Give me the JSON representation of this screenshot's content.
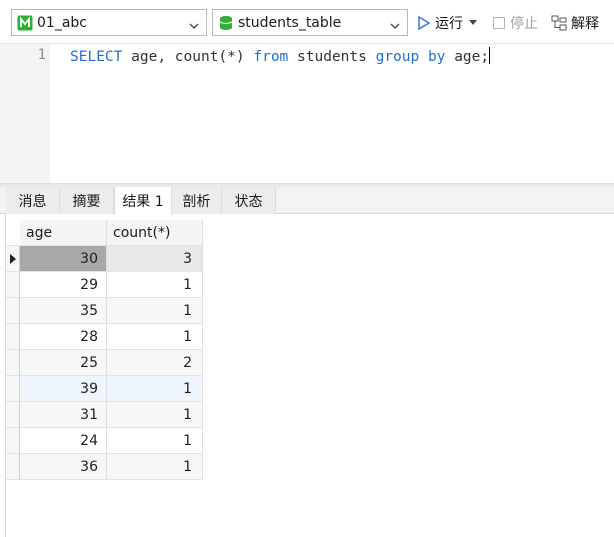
{
  "toolbar": {
    "database": "01_abc",
    "table": "students_table",
    "run_label": "运行",
    "stop_label": "停止",
    "explain_label": "解释"
  },
  "editor": {
    "line_number": "1",
    "query": "SELECT age, count(*) from students group by age;"
  },
  "tabs": [
    {
      "label": "消息"
    },
    {
      "label": "摘要"
    },
    {
      "label": "结果 1",
      "active": true
    },
    {
      "label": "剖析"
    },
    {
      "label": "状态"
    }
  ],
  "result": {
    "columns": [
      "age",
      "count(*)"
    ],
    "rows": [
      {
        "age": "30",
        "count": "3"
      },
      {
        "age": "29",
        "count": "1"
      },
      {
        "age": "35",
        "count": "1"
      },
      {
        "age": "28",
        "count": "1"
      },
      {
        "age": "25",
        "count": "2"
      },
      {
        "age": "39",
        "count": "1"
      },
      {
        "age": "31",
        "count": "1"
      },
      {
        "age": "24",
        "count": "1"
      },
      {
        "age": "36",
        "count": "1"
      }
    ]
  },
  "colors": {
    "keyword": "#1f6fd1",
    "run_icon": "#3a7bd5",
    "db_icon": "#2fae3a",
    "selected_cell": "#a8a8a8"
  },
  "icons": {
    "database": "green-db-icon",
    "table": "green-table-icon",
    "run": "play-icon",
    "stop": "stop-icon",
    "explain": "explain-icon"
  }
}
